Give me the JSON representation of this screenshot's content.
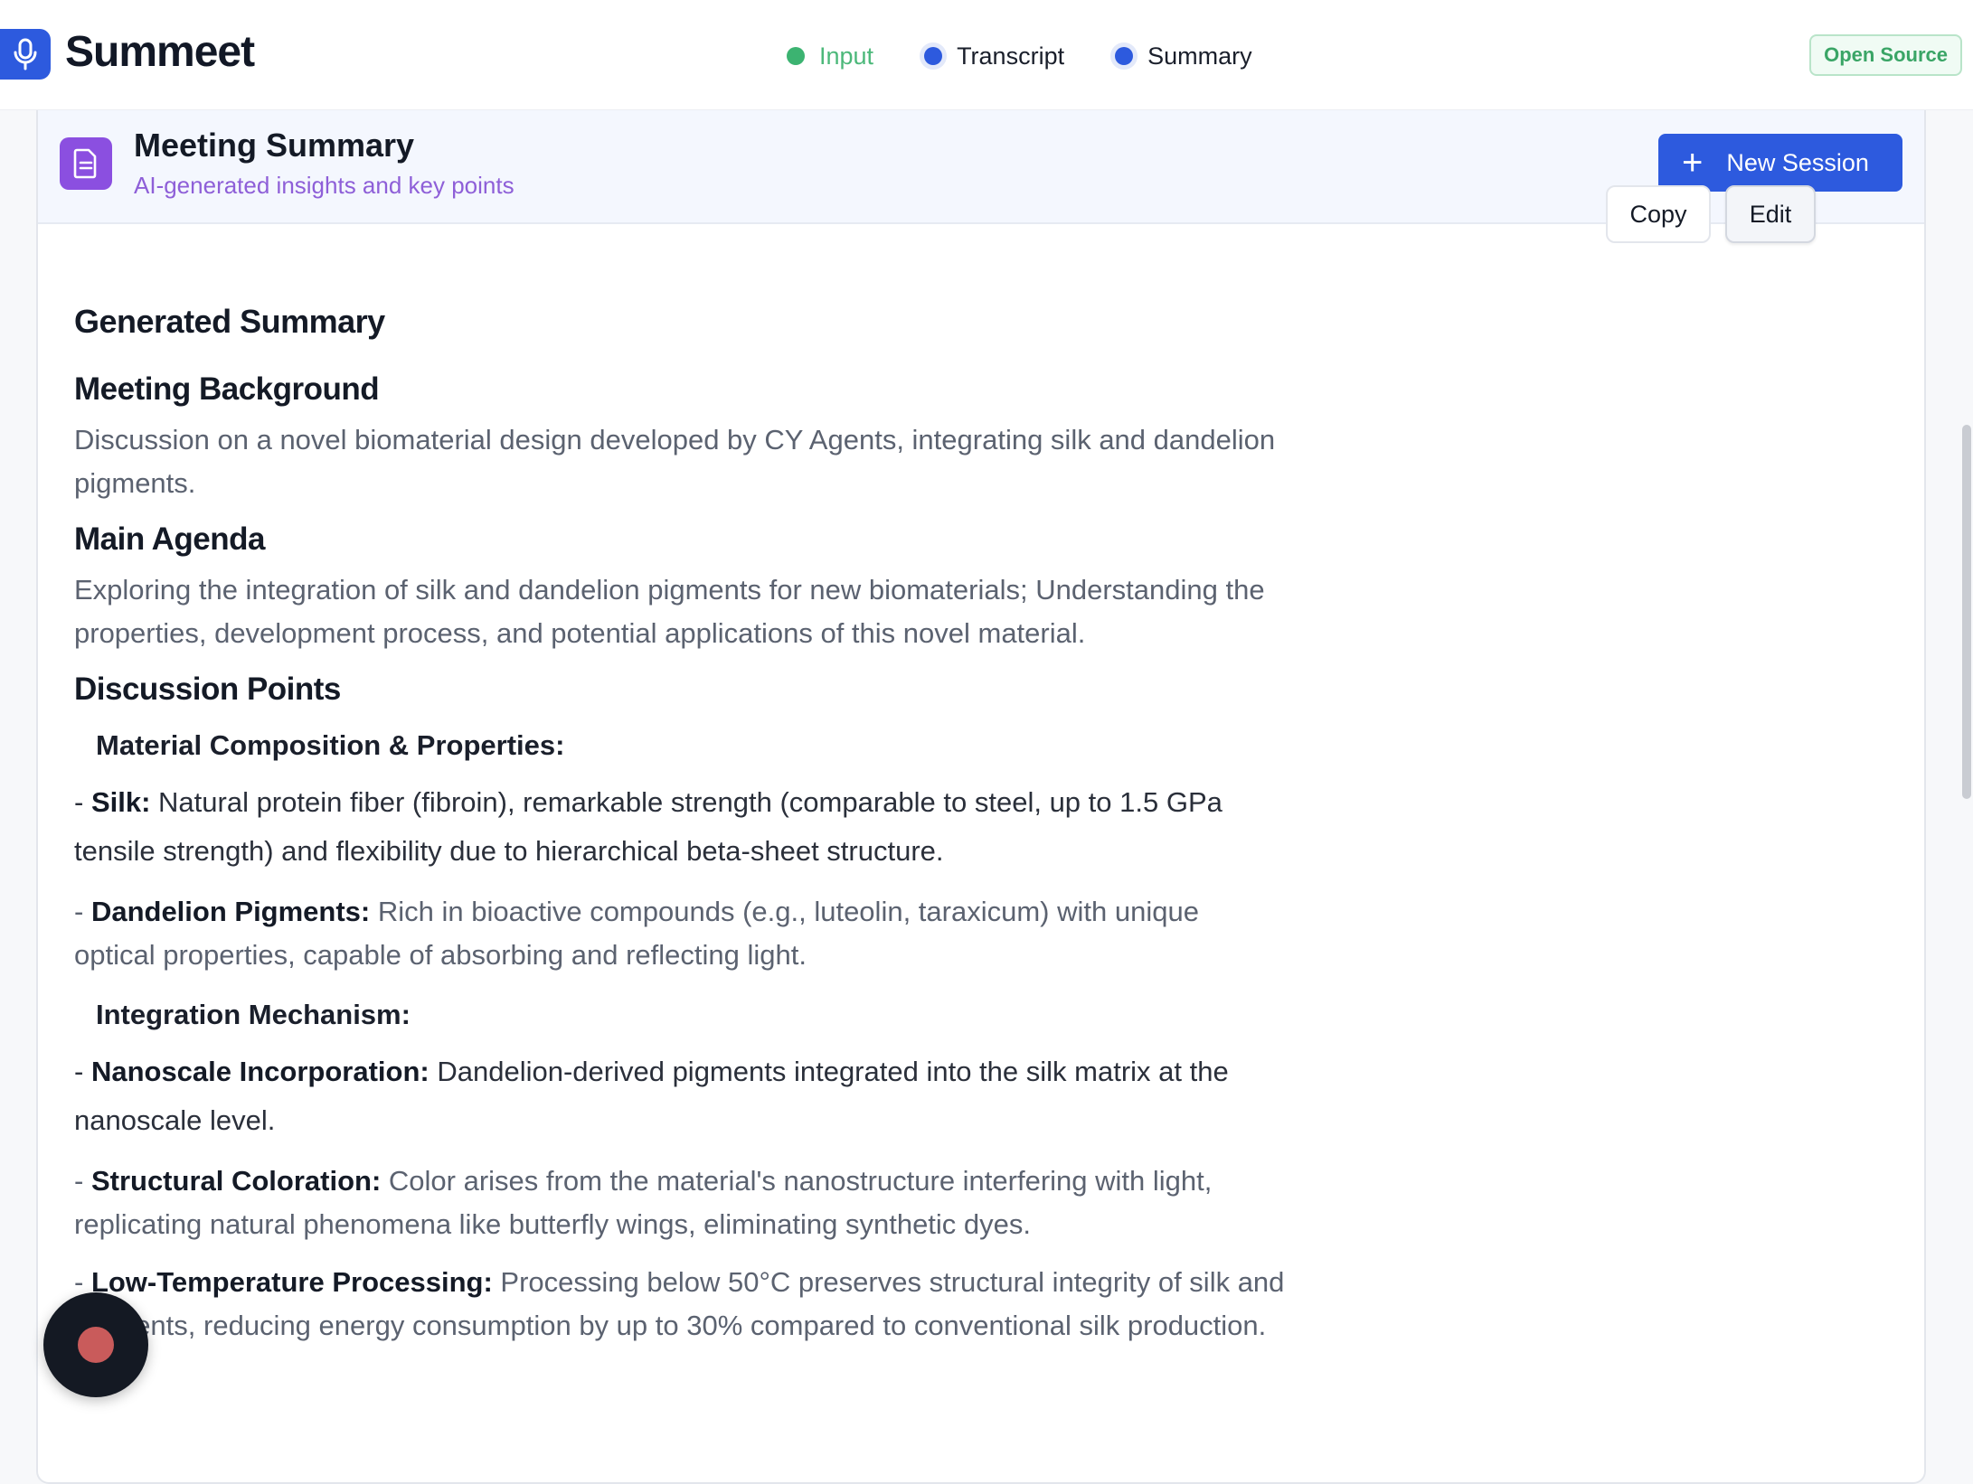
{
  "app": {
    "title": "Summeet",
    "badge": "Open Source"
  },
  "steps": [
    {
      "label": "Input",
      "state": "done"
    },
    {
      "label": "Transcript",
      "state": "active"
    },
    {
      "label": "Summary",
      "state": "active"
    }
  ],
  "card": {
    "title": "Meeting Summary",
    "subtitle": "AI-generated insights and key points",
    "new_session_label": "New Session"
  },
  "summary": {
    "title": "Generated Summary",
    "copy_label": "Copy",
    "edit_label": "Edit",
    "background_heading": "Meeting Background",
    "background_text": "Discussion on a novel biomaterial design developed by CY Agents, integrating silk and dandelion pigments.",
    "agenda_heading": "Main Agenda",
    "agenda_text": "Exploring the integration of silk and dandelion pigments for new biomaterials; Understanding the properties, development process, and potential applications of this novel material.",
    "discussion_heading": "Discussion Points",
    "composition_heading": "Material Composition & Properties:",
    "silk_label": "Silk:",
    "silk_text": " Natural protein fiber (fibroin), remarkable strength (comparable to steel, up to 1.5 GPa tensile strength) and flexibility due to hierarchical beta-sheet structure.",
    "dandelion_label": "Dandelion Pigments:",
    "dandelion_text": " Rich in bioactive compounds (e.g., luteolin, taraxicum) with unique optical properties, capable of absorbing and reflecting light.",
    "integration_heading": "Integration Mechanism:",
    "nanoscale_label": "Nanoscale Incorporation:",
    "nanoscale_text": " Dandelion-derived pigments integrated into the silk matrix at the nanoscale level.",
    "structural_label": "Structural Coloration:",
    "structural_text": " Color arises from the material's nanostructure interfering with light, replicating natural phenomena like butterfly wings, eliminating synthetic dyes.",
    "lowtemp_label": "Low-Temperature Processing:",
    "lowtemp_text": " Processing below 50°C preserves structural integrity of silk and pigments, reducing energy consumption by up to 30% compared to conventional silk production."
  },
  "colors": {
    "accent": "#2d5ade",
    "success": "#3cb371",
    "purple": "#8b4fe0"
  }
}
